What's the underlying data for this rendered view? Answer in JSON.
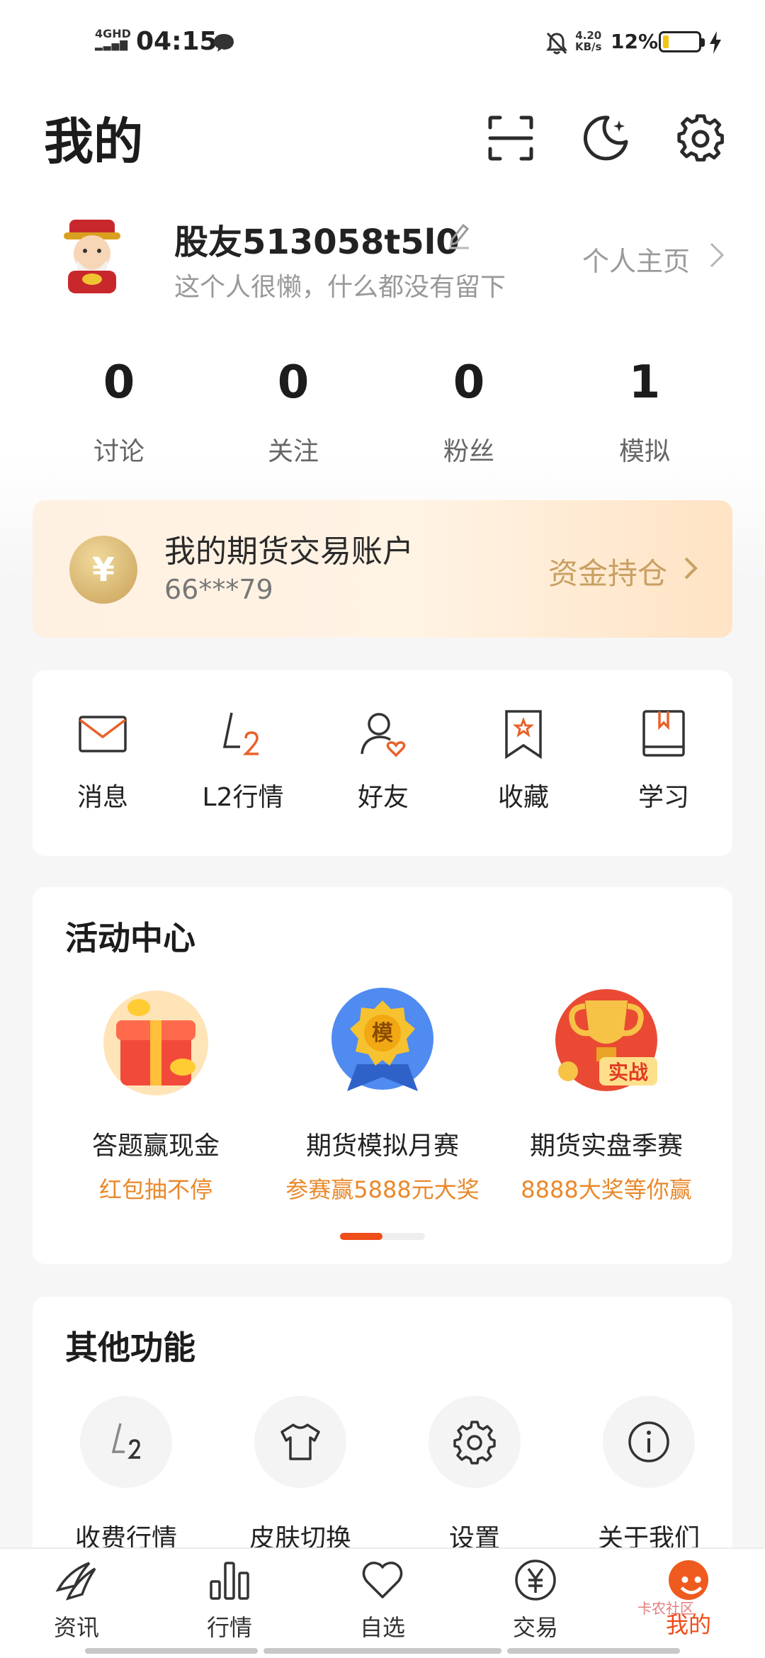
{
  "status_bar": {
    "network": "4GHD",
    "time": "04:15",
    "speed_value": "4.20",
    "speed_unit": "KB/s",
    "battery": "12%"
  },
  "header": {
    "title": "我的"
  },
  "profile": {
    "username": "股友513058t5l0",
    "bio": "这个人很懒，什么都没有留下",
    "homepage_link": "个人主页"
  },
  "stats": [
    {
      "value": "0",
      "label": "讨论"
    },
    {
      "value": "0",
      "label": "关注"
    },
    {
      "value": "0",
      "label": "粉丝"
    },
    {
      "value": "1",
      "label": "模拟"
    }
  ],
  "account": {
    "coin_symbol": "¥",
    "title": "我的期货交易账户",
    "number": "66***79",
    "link": "资金持仓"
  },
  "quick_actions": [
    {
      "label": "消息",
      "icon": "mail-icon"
    },
    {
      "label": "L2行情",
      "icon": "l2-icon"
    },
    {
      "label": "好友",
      "icon": "friend-icon"
    },
    {
      "label": "收藏",
      "icon": "bookmark-star-icon"
    },
    {
      "label": "学习",
      "icon": "book-icon"
    }
  ],
  "activities": {
    "title": "活动中心",
    "items": [
      {
        "name": "答题赢现金",
        "sub": "红包抽不停",
        "icon": "gift-box-icon"
      },
      {
        "name": "期货模拟月赛",
        "sub": "参赛赢5888元大奖",
        "icon": "medal-icon",
        "badge": "模"
      },
      {
        "name": "期货实盘季赛",
        "sub": "8888大奖等你赢",
        "icon": "trophy-icon",
        "badge": "实战"
      }
    ],
    "page_index": 1,
    "page_count": 2
  },
  "other_features": {
    "title": "其他功能",
    "items": [
      {
        "label": "收费行情",
        "icon": "l2-icon"
      },
      {
        "label": "皮肤切换",
        "icon": "tshirt-icon"
      },
      {
        "label": "设置",
        "icon": "gear-icon"
      },
      {
        "label": "关于我们",
        "icon": "info-icon"
      }
    ]
  },
  "bottom_nav": {
    "items": [
      {
        "label": "资讯",
        "icon": "news-icon"
      },
      {
        "label": "行情",
        "icon": "bar-chart-icon"
      },
      {
        "label": "自选",
        "icon": "heart-icon"
      },
      {
        "label": "交易",
        "icon": "yen-icon"
      },
      {
        "label": "我的",
        "icon": "mascot-icon",
        "active": true
      }
    ],
    "watermark": "卡农社区"
  },
  "colors": {
    "accent": "#ef4d1a",
    "activity_sub": "#e9892c",
    "account_link": "#c9a062"
  }
}
